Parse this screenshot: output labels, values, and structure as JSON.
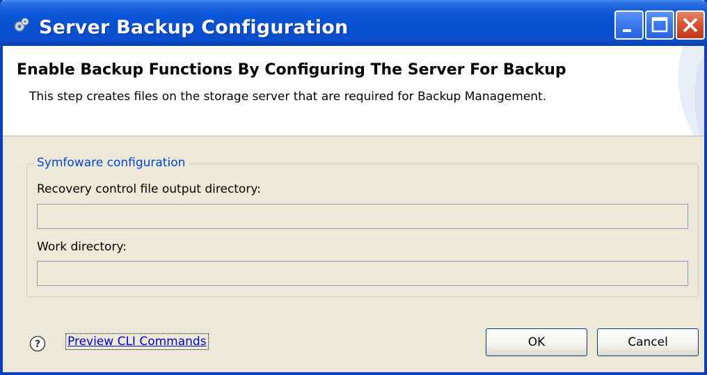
{
  "window": {
    "title": "Server Backup Configuration",
    "title_icon": "app-gear-icon",
    "controls": {
      "minimize_icon": "minimize-icon",
      "maximize_icon": "maximize-icon",
      "close_icon": "close-icon"
    }
  },
  "header": {
    "title": "Enable Backup Functions By Configuring The Server For Backup",
    "description": "This step creates files on the storage server that are required for Backup Management."
  },
  "group": {
    "legend": "Symfoware configuration",
    "fields": [
      {
        "label": "Recovery control file output directory:",
        "value": ""
      },
      {
        "label": "Work directory:",
        "value": ""
      }
    ]
  },
  "footer": {
    "help_icon": "help-icon",
    "link_label": "Preview CLI Commands",
    "ok_label": "OK",
    "cancel_label": "Cancel"
  },
  "colors": {
    "titlebar": "#0a56d8",
    "dialog_bg": "#ece9d8",
    "legend_text": "#0046d5",
    "link_text": "#0000cc",
    "close_button": "#d8552f"
  }
}
